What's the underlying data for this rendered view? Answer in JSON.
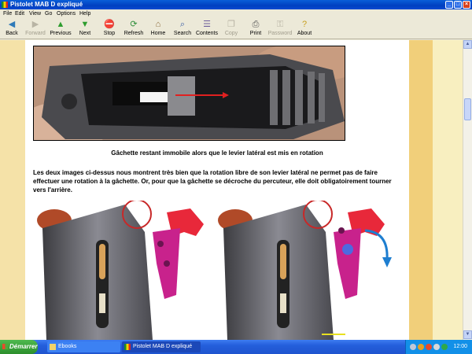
{
  "window": {
    "title": "Pistolet MAB D expliqué"
  },
  "menu": [
    "File",
    "Edit",
    "View",
    "Go",
    "Options",
    "Help"
  ],
  "toolbar": [
    {
      "label": "Back",
      "icon": "back-arrow-icon",
      "enabled": true
    },
    {
      "label": "Forward",
      "icon": "forward-arrow-icon",
      "enabled": false
    },
    {
      "label": "Previous",
      "icon": "up-arrow-icon",
      "enabled": true
    },
    {
      "label": "Next",
      "icon": "down-arrow-icon",
      "enabled": true
    },
    {
      "label": "Stop",
      "icon": "stop-icon",
      "enabled": true
    },
    {
      "label": "Refresh",
      "icon": "refresh-icon",
      "enabled": true
    },
    {
      "label": "Home",
      "icon": "home-icon",
      "enabled": true
    },
    {
      "label": "Search",
      "icon": "search-icon",
      "enabled": true
    },
    {
      "label": "Contents",
      "icon": "contents-icon",
      "enabled": true
    },
    {
      "label": "Copy",
      "icon": "copy-icon",
      "enabled": false
    },
    {
      "label": "Print",
      "icon": "print-icon",
      "enabled": true
    },
    {
      "label": "Password",
      "icon": "key-icon",
      "enabled": false
    },
    {
      "label": "About",
      "icon": "about-icon",
      "enabled": true
    }
  ],
  "content": {
    "caption": "Gâchette restant immobile alors que le levier latéral est mis en rotation",
    "paragraph": "Les deux images ci-dessus nous montrent très bien que la rotation libre de son levier latéral ne permet pas de faire effectuer une rotation à la gâchette. Or, pour que la gâchette se décroche du percuteur, elle doit obligatoirement tourner vers l'arrière."
  },
  "taskbar": {
    "start_label": "Démarrer",
    "tasks": [
      "Ebooks",
      "Pistolet MAB D expliqué"
    ],
    "clock": "12:00"
  },
  "colors": {
    "titlebar": "#0a4ad0",
    "page_left_stripe": "#f5e2a8",
    "page_right_stripe": "#f1cf7a",
    "trigger_red": "#e8283a",
    "lever_magenta": "#c8228c"
  }
}
